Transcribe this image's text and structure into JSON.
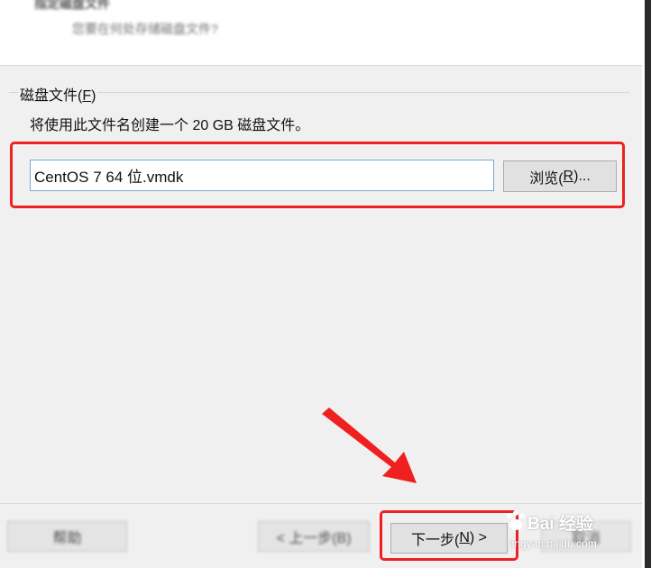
{
  "header": {
    "title": "指定磁盘文件",
    "subtitle": "您要在何处存储磁盘文件?"
  },
  "disk_file_group": {
    "legend_main": "磁盘文件(",
    "legend_mnemonic": "F",
    "legend_end": ")",
    "description": "将使用此文件名创建一个 20 GB 磁盘文件。",
    "filename_value": "CentOS 7 64 位.vmdk",
    "browse_main": "浏览(",
    "browse_mnemonic": "R",
    "browse_end": ")..."
  },
  "footer": {
    "help_label": "帮助",
    "back_label": "< 上一步(B)",
    "next_main": "下一步(",
    "next_mnemonic": "N",
    "next_end": ") >",
    "cancel_label": "取消"
  },
  "watermark": {
    "brand": "Bai 经验",
    "url": "jingyan.baidu.com"
  },
  "colors": {
    "highlight": "#ee2020",
    "input_border": "#7aa7d8"
  }
}
